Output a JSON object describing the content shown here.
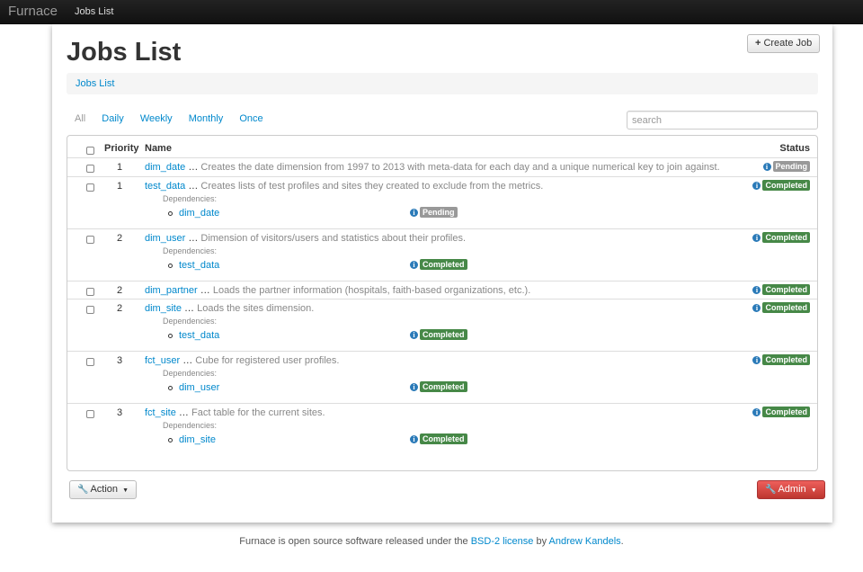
{
  "navbar": {
    "brand": "Furnace",
    "links": [
      "Jobs List"
    ]
  },
  "header": {
    "title": "Jobs List",
    "create_button": "Create Job",
    "create_icon": "plus-icon"
  },
  "breadcrumb": [
    "Jobs List"
  ],
  "filters": {
    "tabs": [
      "All",
      "Daily",
      "Weekly",
      "Monthly",
      "Once"
    ],
    "active": "All"
  },
  "search": {
    "placeholder": "search",
    "value": ""
  },
  "table": {
    "columns": [
      "Priority",
      "Name",
      "Status"
    ],
    "dependencies_label": "Dependencies:",
    "rows": [
      {
        "priority": "1",
        "name": "dim_date",
        "ellipsis": "…",
        "description": "Creates the date dimension from 1997 to 2013 with meta-data for each day and a unique numerical key to join against.",
        "status": "Pending",
        "dependencies": []
      },
      {
        "priority": "1",
        "name": "test_data",
        "ellipsis": "…",
        "description": "Creates lists of test profiles and sites they created to exclude from the metrics.",
        "status": "Completed",
        "dependencies": [
          {
            "name": "dim_date",
            "status": "Pending"
          }
        ]
      },
      {
        "priority": "2",
        "name": "dim_user",
        "ellipsis": "…",
        "description": "Dimension of visitors/users and statistics about their profiles.",
        "status": "Completed",
        "dependencies": [
          {
            "name": "test_data",
            "status": "Completed"
          }
        ]
      },
      {
        "priority": "2",
        "name": "dim_partner",
        "ellipsis": "…",
        "description": "Loads the partner information (hospitals, faith-based organizations, etc.).",
        "status": "Completed",
        "dependencies": []
      },
      {
        "priority": "2",
        "name": "dim_site",
        "ellipsis": "…",
        "description": "Loads the sites dimension.",
        "status": "Completed",
        "dependencies": [
          {
            "name": "test_data",
            "status": "Completed"
          }
        ]
      },
      {
        "priority": "3",
        "name": "fct_user",
        "ellipsis": "…",
        "description": "Cube for registered user profiles.",
        "status": "Completed",
        "dependencies": [
          {
            "name": "dim_user",
            "status": "Completed"
          }
        ]
      },
      {
        "priority": "3",
        "name": "fct_site",
        "ellipsis": "…",
        "description": "Fact table for the current sites.",
        "status": "Completed",
        "dependencies": [
          {
            "name": "dim_site",
            "status": "Completed"
          }
        ]
      }
    ]
  },
  "actions": {
    "action_button": "Action",
    "admin_button": "Admin"
  },
  "footer": {
    "text_before": "Furnace is open source software released under the",
    "license_link": "BSD-2 license",
    "text_middle": "by",
    "author_link": "Andrew Kandels",
    "text_after": "."
  },
  "colors": {
    "completed": "#468847",
    "pending": "#999999",
    "admin": "#da4f49",
    "link": "#0088cc"
  }
}
